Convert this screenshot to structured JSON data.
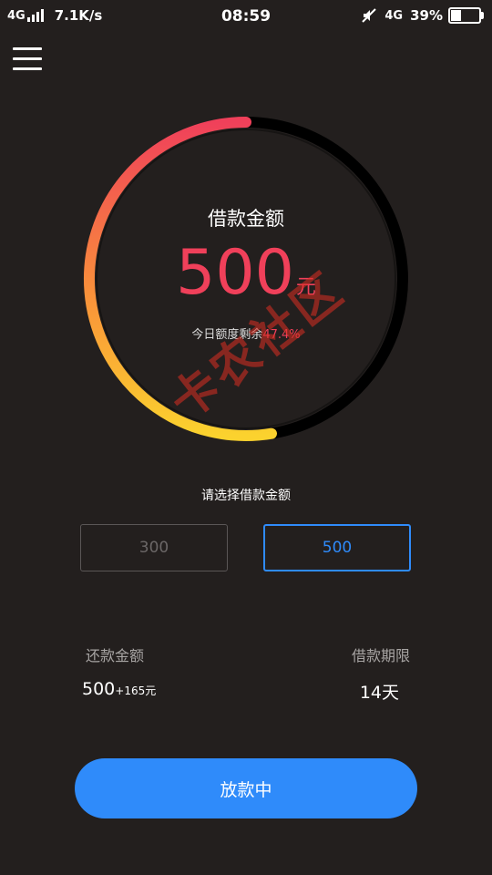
{
  "status_bar": {
    "network_left": "4G",
    "speed": "7.1K/s",
    "time": "08:59",
    "network_right": "4G",
    "battery": "39%",
    "battery_level": 0.39
  },
  "gauge": {
    "title": "借款金额",
    "amount": "500",
    "unit": "元",
    "remaining_label": "今日额度剩余",
    "remaining_pct": "47.4%",
    "progress": 0.526,
    "colors": {
      "start": "#f0405a",
      "middle": "#f9913a",
      "end": "#fbd22e",
      "track": "#000000"
    }
  },
  "watermark": "卡农社区",
  "selector": {
    "label": "请选择借款金额",
    "options": [
      {
        "value": "300",
        "state": "disabled"
      },
      {
        "value": "500",
        "state": "selected"
      }
    ]
  },
  "repayment": {
    "label": "还款金额",
    "principal": "500",
    "interest": "+165元"
  },
  "term": {
    "label": "借款期限",
    "value": "14天"
  },
  "action_button": {
    "label": "放款中",
    "color": "#2f8bfa"
  }
}
